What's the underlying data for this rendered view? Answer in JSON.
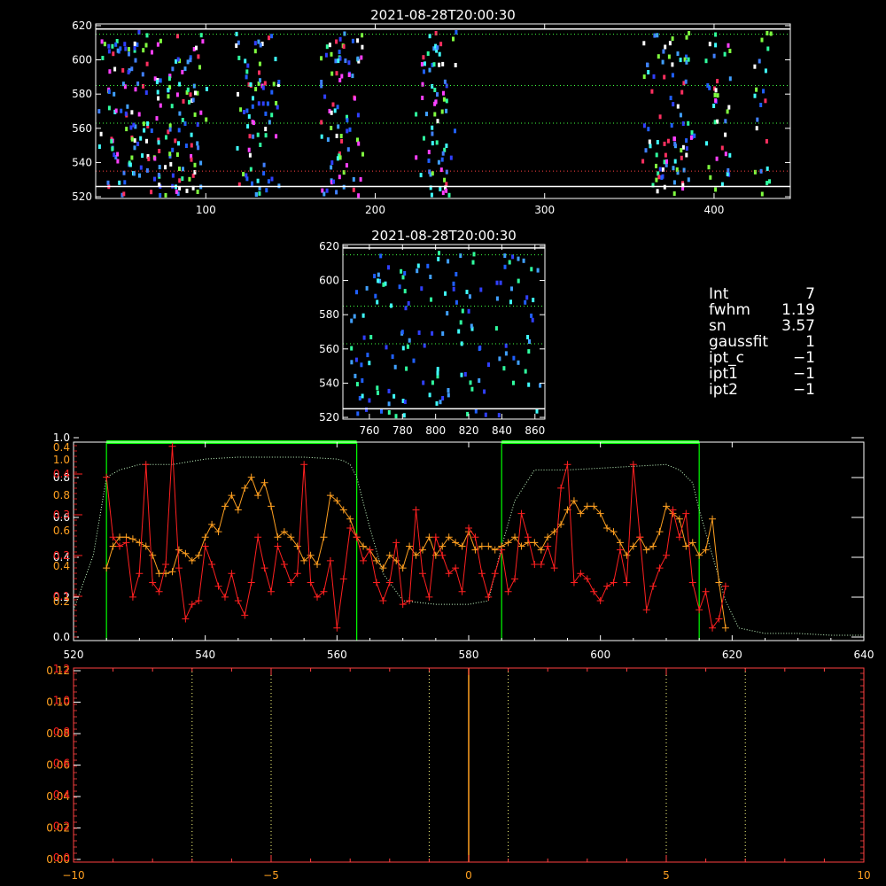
{
  "info": {
    "rows": [
      {
        "label": "Int",
        "value": "7"
      },
      {
        "label": "fwhm",
        "value": "1.19"
      },
      {
        "label": "sn",
        "value": "3.57"
      },
      {
        "label": "gaussfit",
        "value": "1"
      },
      {
        "label": "ipt_c",
        "value": "−1"
      },
      {
        "label": "ipt1",
        "value": "−1"
      },
      {
        "label": "ipt2",
        "value": "−1"
      }
    ]
  },
  "colors": {
    "white": "#ffffff",
    "red": "#ff2020",
    "orange": "#ffa020",
    "green": "#00ff00",
    "lightgreen": "#c8ffc8",
    "yellow": "#ffff80",
    "darkred": "#ff4040"
  },
  "chart_data": [
    {
      "id": "top-image",
      "type": "heatmap",
      "title": "2021-08-28T20:00:30",
      "xlim": [
        35,
        445
      ],
      "ylim": [
        519,
        621
      ],
      "xticks": [
        100,
        200,
        300,
        400
      ],
      "yticks": [
        520,
        540,
        560,
        580,
        600,
        620
      ],
      "white_lines_y": [
        526,
        618
      ],
      "green_dotted_y": [
        563,
        585,
        615
      ],
      "red_dotted_y": [
        535
      ],
      "spot_columns": [
        40,
        45,
        50,
        55,
        60,
        68,
        75,
        80,
        85,
        90,
        95,
        122,
        128,
        132,
        138,
        172,
        177,
        182,
        187,
        228,
        232,
        238,
        242,
        362,
        368,
        373,
        378,
        383,
        398,
        404,
        428
      ]
    },
    {
      "id": "small-image",
      "type": "heatmap",
      "title": "2021-08-28T20:00:30",
      "xlim": [
        744,
        866
      ],
      "ylim": [
        519,
        621
      ],
      "xticks": [
        760,
        780,
        800,
        820,
        840,
        860
      ],
      "yticks": [
        520,
        540,
        560,
        580,
        600,
        620
      ],
      "white_lines_y": [
        525,
        619
      ],
      "green_dotted_y": [
        563,
        585,
        615
      ]
    },
    {
      "id": "profile-plot",
      "type": "line",
      "xlim": [
        520,
        640
      ],
      "xticks": [
        520,
        540,
        560,
        580,
        600,
        620,
        640
      ],
      "yticks_left_white": [
        "0.0",
        "0.2",
        "0.4",
        "0.6",
        "0.8",
        "1.0"
      ],
      "yticks_left_red": [
        "0.1",
        "0.2",
        "0.3",
        "0.4"
      ],
      "yticks_left_orange": [
        "0.2",
        "0.4",
        "0.6",
        "0.8",
        "1.0"
      ],
      "green_boxes": [
        [
          525,
          563
        ],
        [
          585,
          615
        ]
      ],
      "series": [
        {
          "id": "red",
          "x": [
            525,
            526,
            527,
            528,
            529,
            530,
            531,
            532,
            533,
            534,
            535,
            536,
            537,
            538,
            539,
            540,
            541,
            542,
            543,
            544,
            545,
            546,
            547,
            548,
            549,
            550,
            551,
            552,
            553,
            554,
            555,
            556,
            557,
            558,
            559,
            560,
            561,
            562,
            563,
            564,
            565,
            566,
            567,
            568,
            569,
            570,
            571,
            572,
            573,
            574,
            575,
            576,
            577,
            578,
            579,
            580,
            581,
            582,
            583,
            584,
            585,
            586,
            587,
            588,
            589,
            590,
            591,
            592,
            593,
            594,
            595,
            596,
            597,
            598,
            599,
            600,
            601,
            602,
            603,
            604,
            605,
            606,
            607,
            608,
            609,
            610,
            611,
            612,
            613,
            614,
            615,
            616,
            617,
            618,
            619
          ],
          "values": [
            0.88,
            0.55,
            0.5,
            0.52,
            0.22,
            0.35,
            0.95,
            0.3,
            0.25,
            0.4,
            1.15,
            0.38,
            0.1,
            0.18,
            0.2,
            0.5,
            0.4,
            0.28,
            0.22,
            0.35,
            0.2,
            0.12,
            0.3,
            0.55,
            0.38,
            0.25,
            0.5,
            0.4,
            0.3,
            0.35,
            0.95,
            0.3,
            0.22,
            0.25,
            0.42,
            0.05,
            0.32,
            0.6,
            0.55,
            0.42,
            0.48,
            0.3,
            0.2,
            0.3,
            0.52,
            0.18,
            0.2,
            0.7,
            0.35,
            0.22,
            0.55,
            0.45,
            0.35,
            0.38,
            0.25,
            0.6,
            0.55,
            0.35,
            0.22,
            0.35,
            0.48,
            0.25,
            0.32,
            0.68,
            0.55,
            0.4,
            0.4,
            0.5,
            0.38,
            0.82,
            0.95,
            0.3,
            0.35,
            0.32,
            0.25,
            0.2,
            0.28,
            0.3,
            0.48,
            0.3,
            0.95,
            0.55,
            0.15,
            0.28,
            0.38,
            0.45,
            0.7,
            0.55,
            0.68,
            0.3,
            0.15,
            0.25,
            0.05,
            0.1,
            0.28
          ]
        },
        {
          "id": "orange",
          "x": [
            525,
            526,
            527,
            528,
            529,
            530,
            531,
            532,
            533,
            534,
            535,
            536,
            537,
            538,
            539,
            540,
            541,
            542,
            543,
            544,
            545,
            546,
            547,
            548,
            549,
            550,
            551,
            552,
            553,
            554,
            555,
            556,
            557,
            558,
            559,
            560,
            561,
            562,
            563,
            564,
            565,
            566,
            567,
            568,
            569,
            570,
            571,
            572,
            573,
            574,
            575,
            576,
            577,
            578,
            579,
            580,
            581,
            582,
            583,
            584,
            585,
            586,
            587,
            588,
            589,
            590,
            591,
            592,
            593,
            594,
            595,
            596,
            597,
            598,
            599,
            600,
            601,
            602,
            603,
            604,
            605,
            606,
            607,
            608,
            609,
            610,
            611,
            612,
            613,
            614,
            615,
            616,
            617,
            618,
            619
          ],
          "values": [
            0.38,
            0.5,
            0.55,
            0.55,
            0.54,
            0.52,
            0.5,
            0.45,
            0.35,
            0.35,
            0.36,
            0.48,
            0.46,
            0.42,
            0.45,
            0.55,
            0.62,
            0.58,
            0.72,
            0.78,
            0.7,
            0.82,
            0.88,
            0.78,
            0.85,
            0.72,
            0.55,
            0.58,
            0.55,
            0.5,
            0.42,
            0.45,
            0.4,
            0.55,
            0.78,
            0.75,
            0.7,
            0.65,
            0.55,
            0.5,
            0.48,
            0.42,
            0.38,
            0.45,
            0.42,
            0.38,
            0.5,
            0.45,
            0.48,
            0.55,
            0.45,
            0.5,
            0.55,
            0.52,
            0.5,
            0.58,
            0.48,
            0.5,
            0.5,
            0.48,
            0.5,
            0.52,
            0.55,
            0.5,
            0.52,
            0.52,
            0.48,
            0.55,
            0.58,
            0.62,
            0.7,
            0.75,
            0.68,
            0.72,
            0.72,
            0.68,
            0.6,
            0.58,
            0.52,
            0.45,
            0.5,
            0.55,
            0.48,
            0.5,
            0.58,
            0.72,
            0.68,
            0.65,
            0.5,
            0.52,
            0.45,
            0.48,
            0.65,
            0.3,
            0.05
          ]
        },
        {
          "id": "green-dotted",
          "x": [
            520,
            523,
            525,
            527,
            530,
            535,
            540,
            545,
            550,
            555,
            560,
            561,
            562,
            563,
            565,
            567,
            570,
            575,
            580,
            583,
            585,
            587,
            590,
            595,
            600,
            605,
            610,
            612,
            614,
            615,
            617,
            619,
            621,
            625,
            630,
            635,
            640
          ],
          "values": [
            0.15,
            0.45,
            0.88,
            0.92,
            0.95,
            0.95,
            0.98,
            0.99,
            0.99,
            0.99,
            0.98,
            0.97,
            0.95,
            0.88,
            0.6,
            0.35,
            0.2,
            0.18,
            0.18,
            0.2,
            0.5,
            0.75,
            0.92,
            0.92,
            0.93,
            0.94,
            0.95,
            0.92,
            0.85,
            0.7,
            0.45,
            0.2,
            0.05,
            0.02,
            0.02,
            0.01,
            0.01
          ]
        }
      ]
    },
    {
      "id": "bottom-plot",
      "type": "line",
      "xlim": [
        -10,
        10
      ],
      "xticks": [
        "−10",
        "−5",
        "0",
        "5",
        "10"
      ],
      "yticks_left_white": [
        "0.00",
        "0.02",
        "0.04",
        "0.06",
        "0.08",
        "0.10",
        "0.12"
      ],
      "yticks_left_red": [
        "0.0",
        "0.2",
        "0.4",
        "0.6",
        "0.8",
        "1.0",
        "1.2"
      ],
      "dotted_x": [
        -7,
        -5,
        -1,
        1,
        5,
        7
      ],
      "solid_x": [
        0
      ]
    }
  ]
}
